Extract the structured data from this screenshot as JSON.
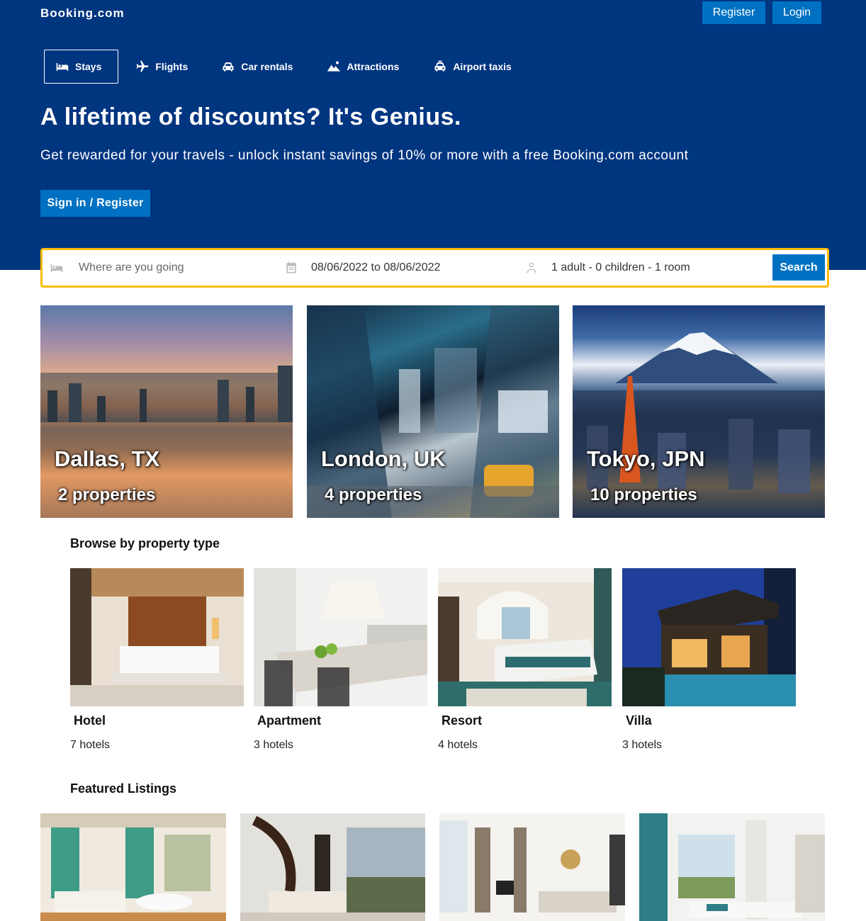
{
  "header": {
    "logo": "Booking.com",
    "register_label": "Register",
    "login_label": "Login",
    "bg_color": "#003580",
    "button_color": "#0071c2"
  },
  "nav": {
    "items": [
      {
        "label": "Stays",
        "icon": "bed-icon",
        "active": true
      },
      {
        "label": "Flights",
        "icon": "plane-icon",
        "active": false
      },
      {
        "label": "Car rentals",
        "icon": "car-icon",
        "active": false
      },
      {
        "label": "Attractions",
        "icon": "mountain-icon",
        "active": false
      },
      {
        "label": "Airport taxis",
        "icon": "taxi-icon",
        "active": false
      }
    ]
  },
  "hero": {
    "title": "A lifetime of discounts? It's Genius.",
    "subtitle": "Get rewarded for your travels - unlock instant savings of 10% or more with a free Booking.com account",
    "cta_label": "Sign in / Register"
  },
  "search": {
    "destination_placeholder": "Where are you going",
    "destination_value": "",
    "dates": "08/06/2022 to 08/06/2022",
    "guests": "1 adult - 0 children - 1 room",
    "search_label": "Search",
    "border_color": "#febb02"
  },
  "cities": [
    {
      "name": "Dallas, TX",
      "properties": "2 properties"
    },
    {
      "name": "London, UK",
      "properties": "4 properties"
    },
    {
      "name": "Tokyo, JPN",
      "properties": "10 properties"
    }
  ],
  "property_types": {
    "title": "Browse by property type",
    "items": [
      {
        "name": "Hotel",
        "count": "7 hotels"
      },
      {
        "name": "Apartment",
        "count": "3 hotels"
      },
      {
        "name": "Resort",
        "count": "4 hotels"
      },
      {
        "name": "Villa",
        "count": "3 hotels"
      }
    ]
  },
  "featured": {
    "title": "Featured Listings",
    "count": 4
  }
}
